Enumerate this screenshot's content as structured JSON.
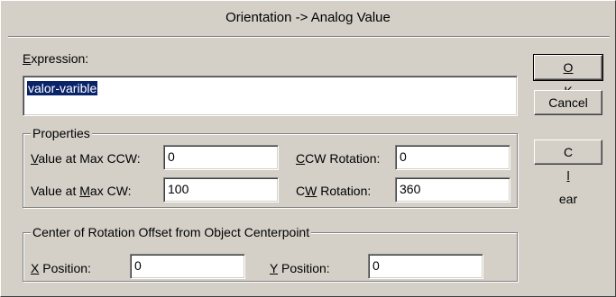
{
  "dialog": {
    "title": "Orientation -> Analog Value"
  },
  "expression": {
    "label_first": "E",
    "label_rest": "xpression:",
    "value": "valor-varible"
  },
  "properties": {
    "group_label": "Properties",
    "value_max_ccw": {
      "label_first": "V",
      "label_rest": "alue at Max CCW:",
      "value": "0"
    },
    "value_max_cw": {
      "label_pre": "Value at ",
      "label_u": "M",
      "label_post": "ax CW:",
      "value": "100"
    },
    "ccw_rotation": {
      "label_first": "C",
      "label_rest": "CW Rotation:",
      "value": "0"
    },
    "cw_rotation": {
      "label_pre": "C",
      "label_u": "W",
      "label_post": " Rotation:",
      "value": "360"
    }
  },
  "center_offset": {
    "group_label": "Center of Rotation Offset from Object Centerpoint",
    "x_position": {
      "label_first": "X",
      "label_rest": " Position:",
      "value": "0"
    },
    "y_position": {
      "label_first": "Y",
      "label_rest": " Position:",
      "value": "0"
    }
  },
  "buttons": {
    "ok": {
      "label_u": "O",
      "label_rest": "K"
    },
    "cancel": {
      "label": "Cancel"
    },
    "clear": {
      "label_pre": "C",
      "label_u": "l",
      "label_post": "ear"
    }
  }
}
